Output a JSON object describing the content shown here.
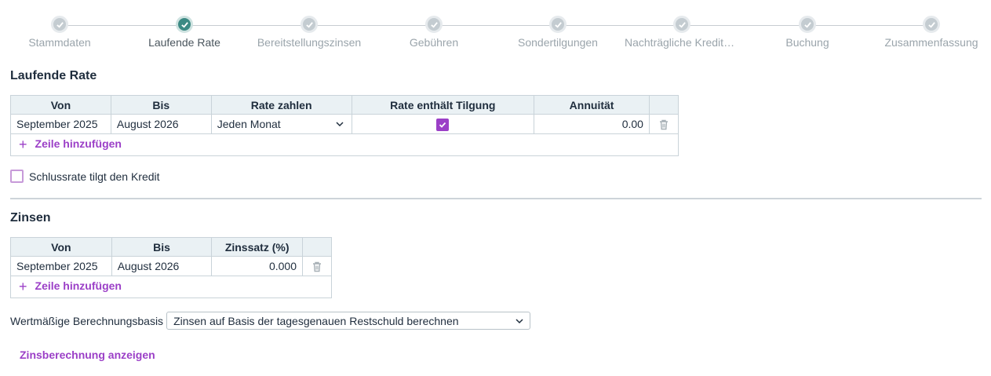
{
  "stepper": {
    "steps": [
      {
        "label": "Stammdaten"
      },
      {
        "label": "Laufende Rate"
      },
      {
        "label": "Bereitstellungszinsen"
      },
      {
        "label": "Gebühren"
      },
      {
        "label": "Sondertilgungen"
      },
      {
        "label": "Nachträgliche Kreditaufnahmen"
      },
      {
        "label": "Buchung"
      },
      {
        "label": "Zusammenfassung"
      }
    ],
    "active_index": 1,
    "accent_color": "#3d8a84"
  },
  "rate": {
    "title": "Laufende Rate",
    "columns": [
      "Von",
      "Bis",
      "Rate zahlen",
      "Rate enthält Tilgung",
      "Annuität"
    ],
    "rows": [
      {
        "von": "September 2025",
        "bis": "August 2026",
        "rate_zahlen": "Jeden Monat",
        "tilgung": true,
        "annuitaet": "0.00"
      }
    ],
    "add_label": "Zeile hinzufügen",
    "schlussrate_label": "Schlussrate tilgt den Kredit"
  },
  "zinsen": {
    "title": "Zinsen",
    "columns": [
      "Von",
      "Bis",
      "Zinssatz (%)"
    ],
    "rows": [
      {
        "von": "September 2025",
        "bis": "August 2026",
        "zinssatz": "0.000"
      }
    ],
    "add_label": "Zeile hinzufügen",
    "basis_label": "Wertmäßige Berechnungsbasis",
    "basis_value": "Zinsen auf Basis der tagesgenauen Restschuld berechnen",
    "show_calc_label": "Zinsberechnung anzeigen"
  },
  "colors": {
    "accent": "#9b3fc7",
    "header_bg": "#eaf1f4"
  }
}
